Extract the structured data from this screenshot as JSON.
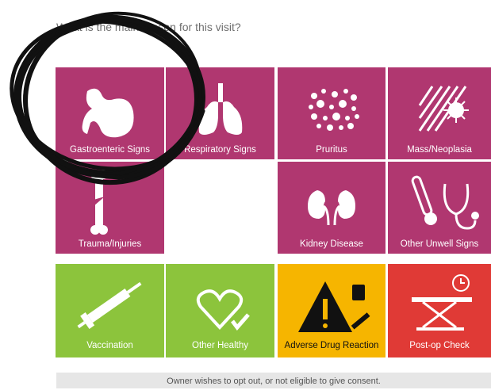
{
  "question": "What is the main reason for this visit?",
  "tiles": [
    {
      "label": "Gastroenteric Signs",
      "icon": "stomach-icon",
      "color": "#b03770"
    },
    {
      "label": "Respiratory Signs",
      "icon": "lungs-icon",
      "color": "#b03770"
    },
    {
      "label": "Pruritus",
      "icon": "dots-icon",
      "color": "#b03770"
    },
    {
      "label": "Mass/Neoplasia",
      "icon": "mass-icon",
      "color": "#b03770"
    },
    {
      "label": "Trauma/Injuries",
      "icon": "bone-icon",
      "color": "#b03770"
    },
    {
      "label": "Kidney Disease",
      "icon": "kidneys-icon",
      "color": "#b03770"
    },
    {
      "label": "Other Unwell Signs",
      "icon": "thermometer-stethoscope-icon",
      "color": "#b03770"
    },
    {
      "label": "Vaccination",
      "icon": "syringe-icon",
      "color": "#8cc43c"
    },
    {
      "label": "Other Healthy",
      "icon": "heart-check-icon",
      "color": "#8cc43c"
    },
    {
      "label": "Adverse Drug Reaction",
      "icon": "warning-icon",
      "color": "#f6b500"
    },
    {
      "label": "Post-op Check",
      "icon": "surgery-table-icon",
      "color": "#e03a36"
    }
  ],
  "opt_out": "Owner wishes to opt out, or not eligible to give consent."
}
